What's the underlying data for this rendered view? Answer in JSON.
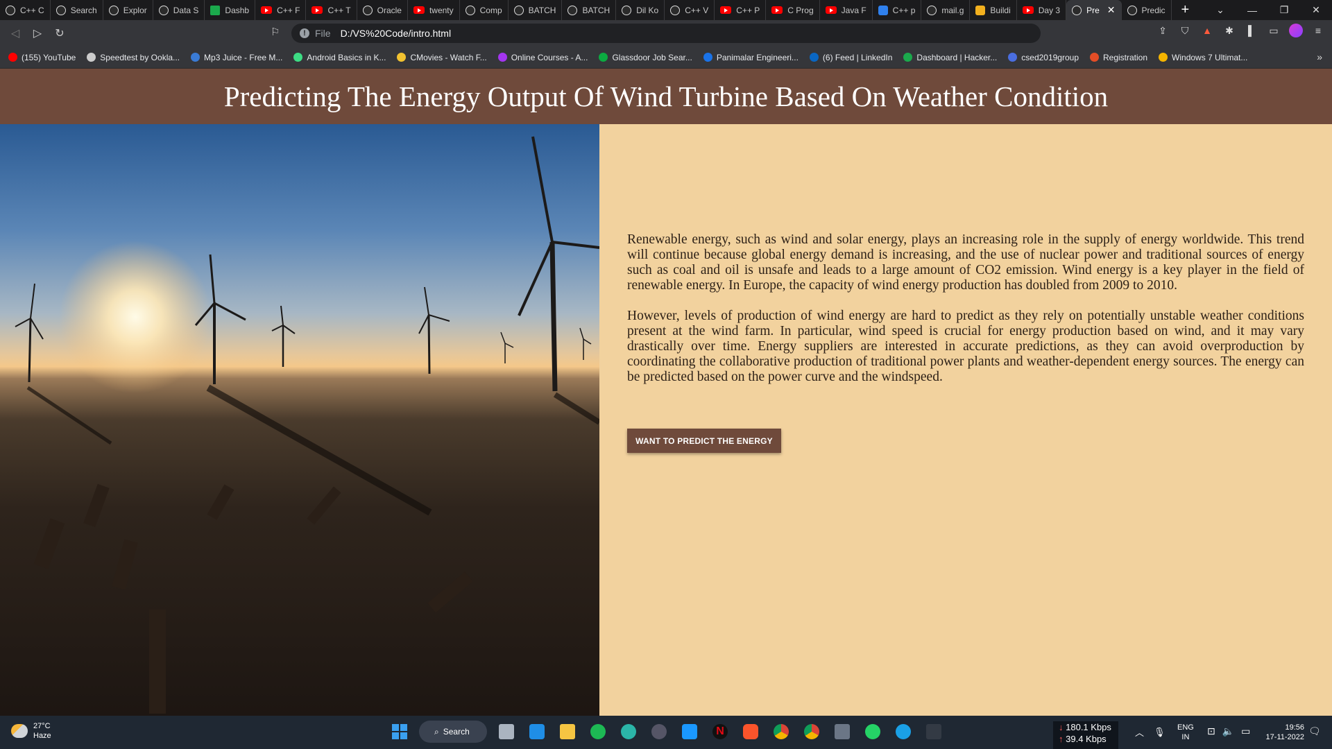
{
  "browser": {
    "tabs": [
      {
        "label": "C++ C",
        "icon": "web"
      },
      {
        "label": "Search",
        "icon": "web"
      },
      {
        "label": "Explor",
        "icon": "web"
      },
      {
        "label": "Data S",
        "icon": "web"
      },
      {
        "label": "Dashb",
        "icon": "hr"
      },
      {
        "label": "C++ F",
        "icon": "yt"
      },
      {
        "label": "C++ T",
        "icon": "yt"
      },
      {
        "label": "Oracle",
        "icon": "web"
      },
      {
        "label": "twenty",
        "icon": "yt"
      },
      {
        "label": "Comp",
        "icon": "web"
      },
      {
        "label": "BATCH",
        "icon": "web"
      },
      {
        "label": "BATCH",
        "icon": "web"
      },
      {
        "label": "Dil Ko",
        "icon": "web"
      },
      {
        "label": "C++ V",
        "icon": "web"
      },
      {
        "label": "C++ P",
        "icon": "yt"
      },
      {
        "label": "C Prog",
        "icon": "yt"
      },
      {
        "label": "Java F",
        "icon": "yt"
      },
      {
        "label": "C++ p",
        "icon": "vs"
      },
      {
        "label": "mail.g",
        "icon": "web"
      },
      {
        "label": "Buildi",
        "icon": "bo"
      },
      {
        "label": "Day 3",
        "icon": "yt"
      },
      {
        "label": "Pre",
        "icon": "web",
        "active": true
      },
      {
        "label": "Predic",
        "icon": "web"
      }
    ],
    "new_tab": "+",
    "address": {
      "scheme": "File",
      "url": "D:/VS%20Code/intro.html"
    },
    "bookmarks": [
      {
        "label": "(155) YouTube",
        "color": "#ff0000"
      },
      {
        "label": "Speedtest by Ookla...",
        "color": "#cccccc"
      },
      {
        "label": "Mp3 Juice - Free M...",
        "color": "#3a7bd5"
      },
      {
        "label": "Android Basics in K...",
        "color": "#3ddc84"
      },
      {
        "label": "CMovies - Watch F...",
        "color": "#f2c230"
      },
      {
        "label": "Online Courses - A...",
        "color": "#a435f0"
      },
      {
        "label": "Glassdoor Job Sear...",
        "color": "#0caa41"
      },
      {
        "label": "Panimalar Engineeri...",
        "color": "#1a73e8"
      },
      {
        "label": "(6) Feed | LinkedIn",
        "color": "#0a66c2"
      },
      {
        "label": "Dashboard | Hacker...",
        "color": "#1ba94c"
      },
      {
        "label": "csed2019group",
        "color": "#4a6ee0"
      },
      {
        "label": "Registration",
        "color": "#e44d26"
      },
      {
        "label": "Windows 7 Ultimat...",
        "color": "#f4b400"
      }
    ],
    "bookmarks_more": "»"
  },
  "page": {
    "title": "Predicting The Energy Output Of Wind Turbine Based On Weather Condition",
    "paragraphs": [
      "Renewable energy, such as wind and solar energy, plays an increasing role in the supply of energy worldwide. This trend will continue because global energy demand is increasing, and the use of nuclear power and traditional sources of energy such as coal and oil is unsafe and leads to a large amount of CO2 emission. Wind energy is a key player in the field of renewable energy. In Europe, the capacity of wind energy production has doubled from 2009 to 2010.",
      "However, levels of production of wind energy are hard to predict as they rely on potentially unstable weather conditions present at the wind farm. In particular, wind speed is crucial for energy production based on wind, and it may vary drastically over time. Energy suppliers are interested in accurate predictions, as they can avoid overproduction by coordinating the collaborative production of traditional power plants and weather-dependent energy sources. The energy can be predicted based on the power curve and the windspeed."
    ],
    "button_label": "WANT TO PREDICT THE ENERGY",
    "colors": {
      "header": "#6f4a3b",
      "background": "#f2d29e",
      "button": "#6f4a3b"
    }
  },
  "taskbar": {
    "weather_temp": "27°C",
    "weather_desc": "Haze",
    "search_label": "Search",
    "net_down": "180.1 Kbps",
    "net_up": "39.4 Kbps",
    "lang_1": "ENG",
    "lang_2": "IN",
    "time": "19:56",
    "date": "17-11-2022"
  }
}
